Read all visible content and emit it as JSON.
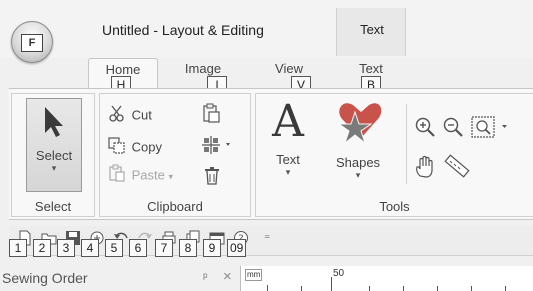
{
  "app": {
    "menu_button_letter": "F",
    "window_title": "Untitled - Layout & Editing",
    "contextual_tab": "Text"
  },
  "tabs": [
    {
      "label": "Home",
      "keytip": "H",
      "active": true
    },
    {
      "label": "Image",
      "keytip": "I",
      "active": false
    },
    {
      "label": "View",
      "keytip": "V",
      "active": false
    },
    {
      "label": "Text",
      "keytip": "B",
      "active": false
    }
  ],
  "ribbon": {
    "select_group": {
      "button_label": "Select",
      "group_label": "Select"
    },
    "clipboard_group": {
      "cut_label": "Cut",
      "copy_label": "Copy",
      "paste_label": "Paste",
      "group_label": "Clipboard"
    },
    "tools_group": {
      "text_label": "Text",
      "shapes_label": "Shapes",
      "group_label": "Tools"
    }
  },
  "quick_access": {
    "keytips": [
      "1",
      "2",
      "3",
      "4",
      "5",
      "6",
      "7",
      "8",
      "9",
      "09"
    ]
  },
  "panel": {
    "title": "Sewing Order",
    "ruler_unit": "mm",
    "ruler_label": "50"
  },
  "colors": {
    "accent_red": "#c9524a",
    "icon_dark": "#3a3a3a",
    "ribbon_bg": "#f8f8f8"
  }
}
